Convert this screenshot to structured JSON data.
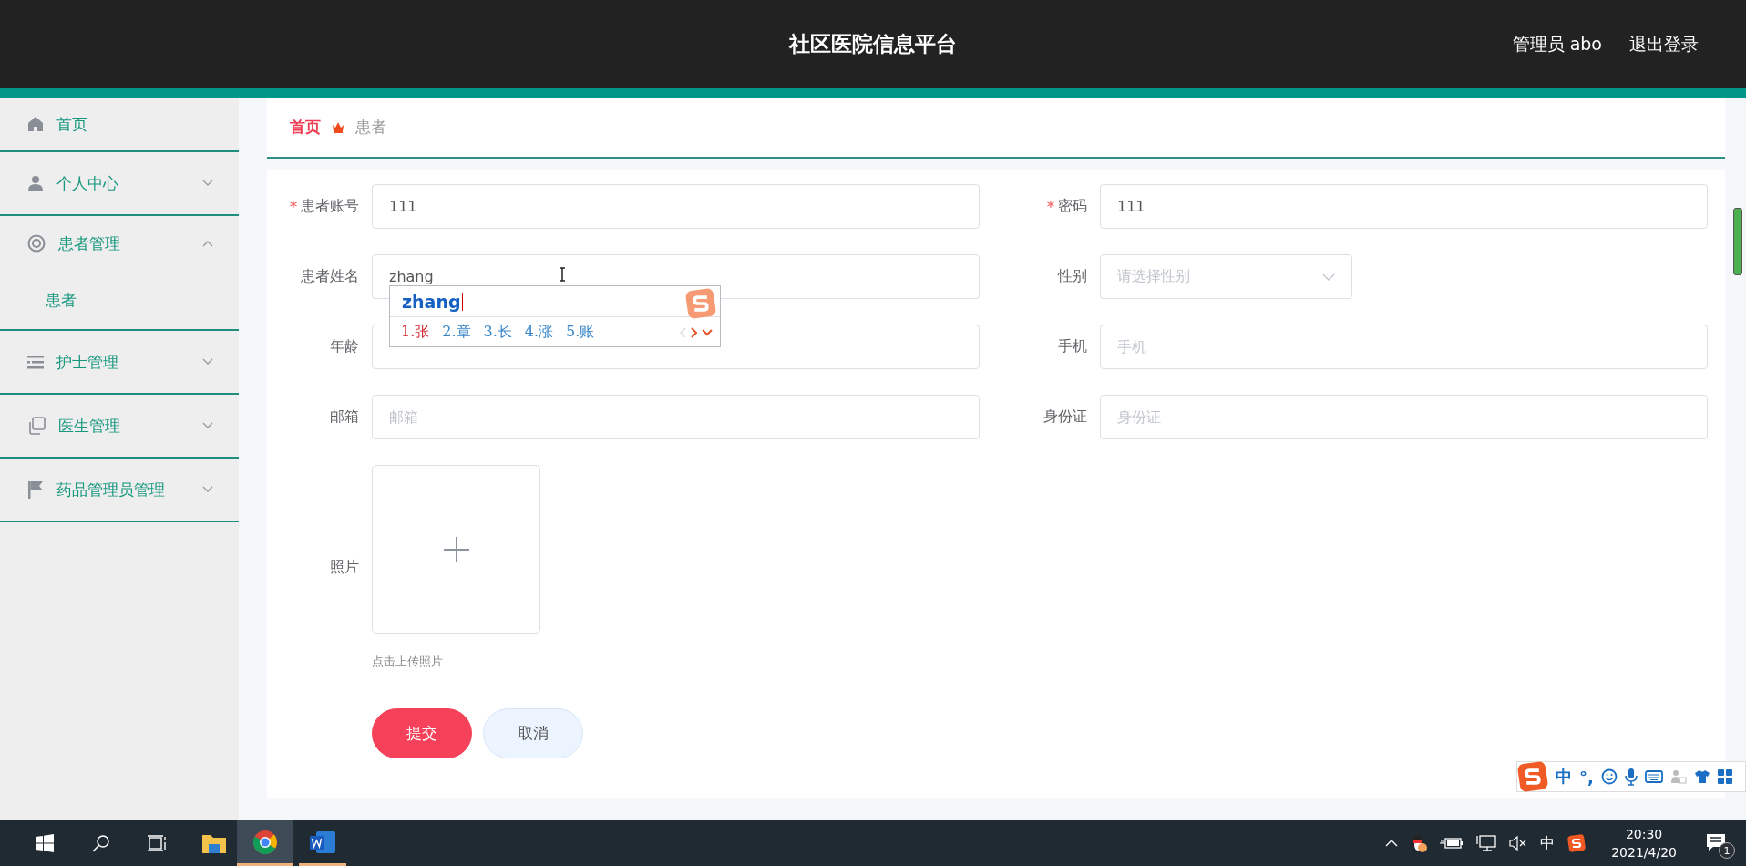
{
  "header": {
    "title": "社区医院信息平台",
    "user": "管理员 abo",
    "logout": "退出登录"
  },
  "sidebar": {
    "items": [
      {
        "label": "首页"
      },
      {
        "label": "个人中心",
        "expanded": false
      },
      {
        "label": "患者管理",
        "expanded": true,
        "children": [
          {
            "label": "患者"
          }
        ]
      },
      {
        "label": "护士管理",
        "expanded": false
      },
      {
        "label": "医生管理",
        "expanded": false
      },
      {
        "label": "药品管理员管理",
        "expanded": false
      }
    ]
  },
  "breadcrumb": [
    {
      "label": "首页"
    },
    {
      "label": "患者"
    }
  ],
  "form": {
    "fields": [
      {
        "kind": "text",
        "label": "患者账号",
        "required": true,
        "value": "111"
      },
      {
        "kind": "text",
        "label": "密码",
        "required": true,
        "value": "111"
      },
      {
        "kind": "text",
        "label": "患者姓名",
        "required": false,
        "value": "zhang"
      },
      {
        "kind": "select",
        "label": "性别",
        "required": false,
        "placeholder": "请选择性别"
      },
      {
        "kind": "text",
        "label": "年龄",
        "required": false
      },
      {
        "kind": "text",
        "label": "手机",
        "required": false,
        "placeholder": "手机"
      },
      {
        "kind": "text",
        "label": "邮箱",
        "required": false,
        "placeholder": "邮箱"
      },
      {
        "kind": "text",
        "label": "身份证",
        "required": false,
        "placeholder": "身份证"
      },
      {
        "kind": "upload",
        "label": "照片",
        "required": false,
        "hint": "点击上传照片"
      }
    ],
    "buttons": [
      {
        "kind": "primary",
        "label": "提交"
      },
      {
        "kind": "default",
        "label": "取消"
      }
    ]
  },
  "ime_popup": {
    "composition": "zhang",
    "candidates": [
      {
        "label": "1.张",
        "selected": true
      },
      {
        "label": "2.章",
        "selected": false
      },
      {
        "label": "3.长",
        "selected": false
      },
      {
        "label": "4.涨",
        "selected": false
      },
      {
        "label": "5.账",
        "selected": false
      }
    ]
  },
  "ime_toolbar": {
    "mode": "中",
    "punctuation": "°,"
  },
  "taskbar": {
    "input_mode": "中",
    "time": "20:30",
    "date": "2021/4/20",
    "notifications": "1"
  }
}
